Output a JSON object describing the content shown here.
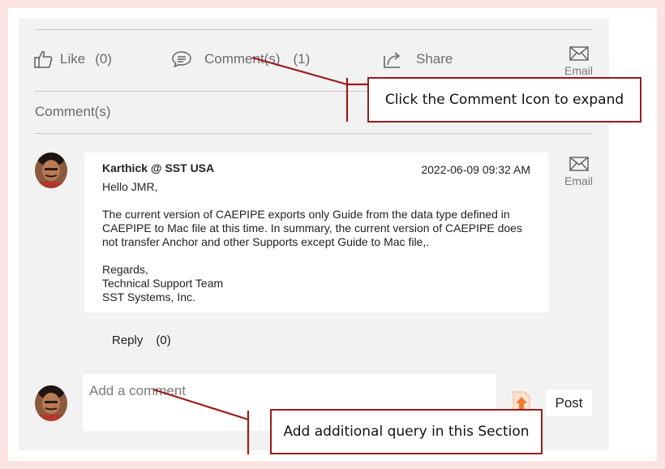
{
  "actions": {
    "like": {
      "label": "Like",
      "count": "(0)"
    },
    "comment": {
      "label": "Comment(s)",
      "count": "(1)"
    },
    "share": {
      "label": "Share"
    },
    "email": {
      "label": "Email"
    }
  },
  "comments_section": {
    "title": "Comment(s)"
  },
  "comment": {
    "author": "Karthick @ SST USA",
    "timestamp": "2022-06-09 09:32 AM",
    "body": [
      "Hello JMR,",
      "",
      "The current version of CAEPIPE exports only Guide from the data type defined in CAEPIPE to Mac file at this time. In summary, the current version of CAEPIPE does not transfer Anchor and other Supports except Guide to Mac file,.",
      "",
      "Regards,",
      "Technical Support Team",
      "SST Systems, Inc."
    ],
    "email_label": "Email",
    "reply_label": "Reply",
    "reply_count": "(0)"
  },
  "new_comment": {
    "placeholder": "Add a comment",
    "post_label": "Post"
  },
  "callouts": {
    "top": "Click the Comment Icon to expand",
    "bottom": "Add additional query in this Section"
  },
  "colors": {
    "accent": "#9b1c1c",
    "upload": "#f07b2f"
  }
}
